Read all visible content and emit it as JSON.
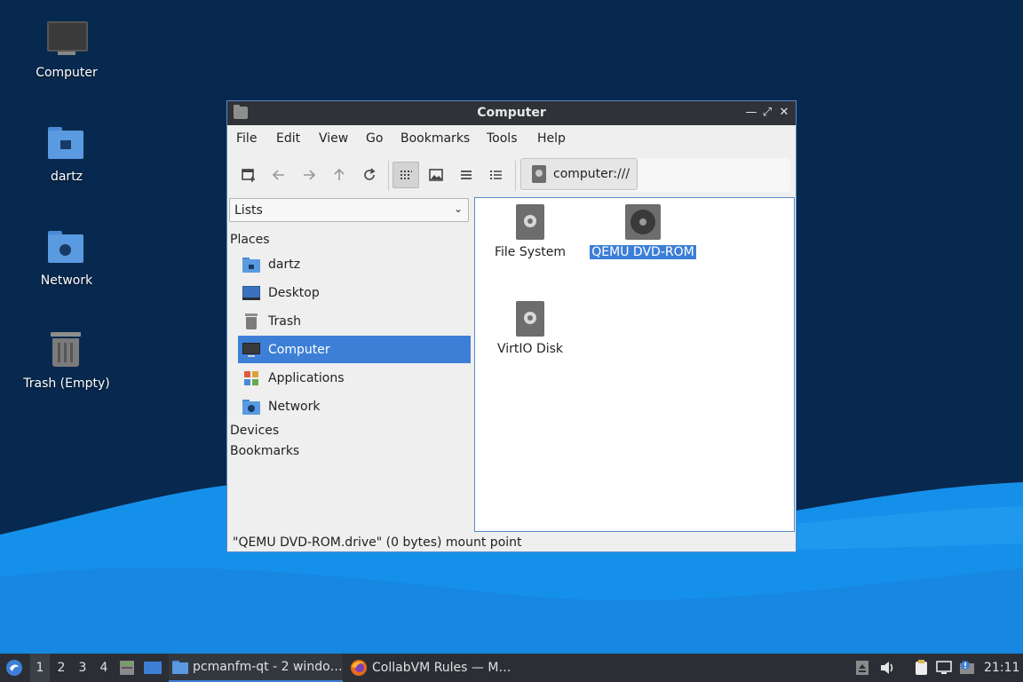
{
  "desktop": {
    "icons": [
      {
        "label": "Computer"
      },
      {
        "label": "dartz"
      },
      {
        "label": "Network"
      },
      {
        "label": "Trash (Empty)"
      }
    ]
  },
  "window": {
    "title": "Computer",
    "menu": [
      "File",
      "Edit",
      "View",
      "Go",
      "Bookmarks",
      "Tools",
      "Help"
    ],
    "address": "computer:///",
    "sidebar": {
      "mode": "Lists",
      "sections": {
        "places": "Places",
        "devices": "Devices",
        "bookmarks": "Bookmarks"
      },
      "places": [
        {
          "label": "dartz",
          "icon": "home-folder-icon"
        },
        {
          "label": "Desktop",
          "icon": "desktop-icon"
        },
        {
          "label": "Trash",
          "icon": "trash-icon"
        },
        {
          "label": "Computer",
          "icon": "computer-icon",
          "selected": true
        },
        {
          "label": "Applications",
          "icon": "applications-icon"
        },
        {
          "label": "Network",
          "icon": "network-icon"
        }
      ]
    },
    "files": [
      {
        "label": "File System",
        "icon": "drive-icon"
      },
      {
        "label": "QEMU DVD-ROM",
        "icon": "optical-drive-icon",
        "selected": true
      },
      {
        "label": "VirtIO Disk",
        "icon": "drive-icon"
      }
    ],
    "status": "\"QEMU DVD-ROM.drive\" (0 bytes) mount point"
  },
  "taskbar": {
    "workspaces": [
      "1",
      "2",
      "3",
      "4"
    ],
    "active_workspace": "1",
    "tasks": [
      {
        "label": "pcmanfm-qt - 2 windo…",
        "active": true
      },
      {
        "label": "CollabVM Rules — M…",
        "active": false
      }
    ],
    "clock": "21:11"
  },
  "colors": {
    "desktop_bg": "#08294f",
    "accent": "#3d7fd6",
    "titlebar": "#2f3338",
    "taskbar": "#2b2f35"
  }
}
